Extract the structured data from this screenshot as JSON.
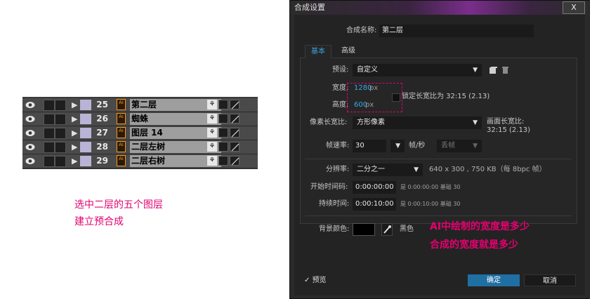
{
  "layers": [
    {
      "num": "25",
      "name": "第二层"
    },
    {
      "num": "26",
      "name": "蜘蛛"
    },
    {
      "num": "27",
      "name": "图层 14"
    },
    {
      "num": "28",
      "name": "二层左树"
    },
    {
      "num": "29",
      "name": "二层右树"
    }
  ],
  "layer_icon_text": "Ai",
  "caption_left": [
    "选中二层的五个图层",
    "建立预合成"
  ],
  "dialog": {
    "title": "合成设置",
    "close_label": "X",
    "name_label": "合成名称:",
    "name_value": "第二层",
    "tabs": [
      "基本",
      "高级"
    ],
    "preset_label": "预设:",
    "preset_value": "自定义",
    "width_label": "宽度:",
    "width_value": "1280",
    "height_label": "高度:",
    "height_value": "600",
    "px_unit": "px",
    "lock_label": "锁定长宽比为 32:15 (2.13)",
    "pixel_aspect_label": "像素长宽比:",
    "pixel_aspect_value": "方形像素",
    "frame_aspect_label": "画面长宽比:",
    "frame_aspect_value": "32:15 (2.13)",
    "fps_label": "帧速率:",
    "fps_value": "30",
    "fps_unit": "帧/秒",
    "drop_frame_value": "丢帧",
    "resolution_label": "分辨率:",
    "resolution_value": "二分之一",
    "resolution_info": "640 x 300 , 750 KB（每 8bpc 帧）",
    "start_tc_label": "开始时间码:",
    "start_tc_value": "0:00:00:00",
    "start_tc_info": "是 0:00:00:00  基础 30",
    "duration_label": "持续时间:",
    "duration_value": "0:00:10:00",
    "duration_info": "是 0:00:10:00  基础 30",
    "bg_color_label": "背景颜色:",
    "bg_color_name": "黑色",
    "preview_label": "预览",
    "ok_label": "确定",
    "cancel_label": "取消"
  },
  "annotation": [
    "AI中绘制的宽度是多少",
    "合成的宽度就是多少"
  ],
  "colors": {
    "accent": "#e4006f",
    "blue": "#3aa6e6",
    "ok_button": "#1f6fa3"
  }
}
